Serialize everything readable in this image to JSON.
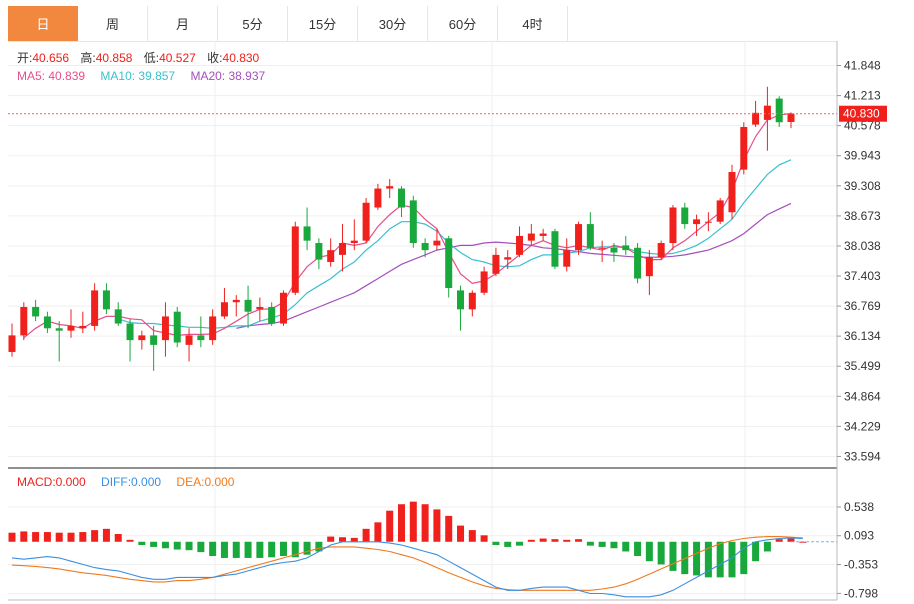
{
  "tabs": [
    {
      "label": "日",
      "active": true
    },
    {
      "label": "周"
    },
    {
      "label": "月"
    },
    {
      "label": "5分"
    },
    {
      "label": "15分"
    },
    {
      "label": "30分"
    },
    {
      "label": "60分"
    },
    {
      "label": "4时"
    }
  ],
  "colors": {
    "up": "#f0201c",
    "down": "#18a83b",
    "ma5": "#e5508a",
    "ma10": "#39c0d0",
    "ma20": "#a44fbd",
    "diff": "#3b8fe0",
    "dea": "#f07a1e",
    "grid": "#efefef",
    "price_line": "#f06060"
  },
  "ohlc": {
    "open_label": "开:",
    "open": "40.656",
    "high_label": "高:",
    "high": "40.858",
    "low_label": "低:",
    "low": "40.527",
    "close_label": "收:",
    "close": "40.830"
  },
  "ma": {
    "ma5_label": "MA5: ",
    "ma5": "40.839",
    "ma10_label": "MA10: ",
    "ma10": "39.857",
    "ma20_label": "MA20: ",
    "ma20": "38.937"
  },
  "macd_legend": {
    "macd_label": "MACD:",
    "macd": "0.000",
    "diff_label": "DIFF:",
    "diff": "0.000",
    "dea_label": "DEA:",
    "dea": "0.000"
  },
  "chart_data": [
    {
      "type": "candlestick",
      "y_ticks": [
        "41.848",
        "41.213",
        "40.578",
        "39.943",
        "39.308",
        "38.673",
        "38.038",
        "37.403",
        "36.769",
        "36.134",
        "35.499",
        "34.864",
        "34.229",
        "33.594"
      ],
      "ylim": [
        33.35,
        42.07
      ],
      "current_price": "40.830",
      "candles": [
        [
          35.8,
          36.15,
          35.7,
          36.4
        ],
        [
          36.15,
          36.75,
          36.05,
          36.85
        ],
        [
          36.75,
          36.55,
          36.45,
          36.9
        ],
        [
          36.55,
          36.3,
          36.2,
          36.65
        ],
        [
          36.3,
          36.25,
          35.6,
          36.45
        ],
        [
          36.25,
          36.35,
          36.1,
          36.7
        ],
        [
          36.3,
          36.35,
          36.2,
          36.65
        ],
        [
          36.35,
          37.1,
          36.25,
          37.25
        ],
        [
          37.1,
          36.7,
          36.6,
          37.25
        ],
        [
          36.7,
          36.4,
          36.35,
          36.85
        ],
        [
          36.4,
          36.05,
          35.6,
          36.5
        ],
        [
          36.05,
          36.15,
          35.85,
          36.25
        ],
        [
          36.15,
          35.95,
          35.4,
          36.35
        ],
        [
          36.05,
          36.55,
          35.7,
          36.85
        ],
        [
          36.65,
          36.0,
          35.9,
          36.75
        ],
        [
          35.95,
          36.15,
          35.6,
          36.3
        ],
        [
          36.15,
          36.05,
          35.9,
          36.55
        ],
        [
          36.05,
          36.55,
          35.95,
          36.7
        ],
        [
          36.55,
          36.85,
          36.5,
          37.15
        ],
        [
          36.85,
          36.9,
          36.55,
          37.0
        ],
        [
          36.9,
          36.65,
          36.3,
          37.2
        ],
        [
          36.7,
          36.75,
          36.45,
          36.95
        ],
        [
          36.75,
          36.4,
          36.35,
          36.85
        ],
        [
          36.4,
          37.05,
          36.35,
          37.1
        ],
        [
          37.05,
          38.45,
          37.0,
          38.55
        ],
        [
          38.45,
          38.15,
          37.95,
          38.85
        ],
        [
          38.1,
          37.75,
          37.55,
          38.2
        ],
        [
          37.7,
          37.95,
          37.6,
          38.2
        ],
        [
          37.85,
          38.1,
          37.5,
          38.5
        ],
        [
          38.1,
          38.15,
          37.95,
          38.6
        ],
        [
          38.15,
          38.95,
          38.1,
          39.05
        ],
        [
          38.85,
          39.25,
          38.8,
          39.35
        ],
        [
          39.25,
          39.3,
          39.05,
          39.45
        ],
        [
          39.25,
          38.85,
          38.65,
          39.3
        ],
        [
          39.0,
          38.1,
          38.0,
          39.1
        ],
        [
          38.1,
          37.95,
          37.8,
          38.2
        ],
        [
          38.05,
          38.15,
          37.95,
          38.4
        ],
        [
          38.2,
          37.15,
          36.95,
          38.25
        ],
        [
          37.1,
          36.7,
          36.25,
          37.2
        ],
        [
          36.7,
          37.05,
          36.55,
          37.1
        ],
        [
          37.05,
          37.5,
          37.0,
          37.6
        ],
        [
          37.45,
          37.85,
          37.4,
          38.0
        ],
        [
          37.75,
          37.8,
          37.55,
          37.95
        ],
        [
          37.85,
          38.25,
          37.8,
          38.45
        ],
        [
          38.15,
          38.3,
          38.05,
          38.5
        ],
        [
          38.25,
          38.3,
          38.15,
          38.4
        ],
        [
          38.35,
          37.6,
          37.55,
          38.4
        ],
        [
          37.6,
          37.95,
          37.5,
          38.2
        ],
        [
          37.95,
          38.5,
          37.85,
          38.55
        ],
        [
          38.5,
          38.0,
          37.95,
          38.75
        ],
        [
          38.0,
          38.0,
          37.7,
          38.15
        ],
        [
          38.0,
          37.9,
          37.7,
          38.1
        ],
        [
          38.05,
          37.95,
          37.85,
          38.25
        ],
        [
          38.0,
          37.35,
          37.25,
          38.1
        ],
        [
          37.4,
          37.8,
          37.0,
          37.95
        ],
        [
          37.8,
          38.1,
          37.75,
          38.15
        ],
        [
          38.1,
          38.85,
          37.95,
          38.9
        ],
        [
          38.85,
          38.5,
          38.4,
          38.95
        ],
        [
          38.5,
          38.6,
          38.25,
          38.7
        ],
        [
          38.55,
          38.55,
          38.35,
          38.75
        ],
        [
          38.55,
          39.0,
          38.5,
          39.05
        ],
        [
          38.75,
          39.6,
          38.6,
          39.75
        ],
        [
          39.65,
          40.55,
          39.55,
          40.65
        ],
        [
          40.6,
          40.85,
          40.55,
          41.1
        ],
        [
          40.7,
          41.0,
          40.05,
          41.4
        ],
        [
          41.15,
          40.65,
          40.55,
          41.2
        ],
        [
          40.656,
          40.83,
          40.527,
          40.858
        ]
      ],
      "ma5": [
        null,
        36.1,
        36.3,
        36.45,
        36.38,
        36.35,
        36.3,
        36.45,
        36.55,
        36.55,
        36.5,
        36.48,
        36.25,
        36.2,
        36.15,
        36.17,
        36.17,
        36.18,
        36.3,
        36.45,
        36.6,
        36.7,
        36.71,
        36.85,
        37.28,
        37.6,
        37.8,
        37.85,
        38.1,
        38.05,
        38.1,
        38.45,
        38.7,
        38.9,
        38.85,
        38.6,
        38.4,
        37.9,
        37.45,
        37.25,
        37.3,
        37.45,
        37.65,
        37.85,
        38.05,
        38.15,
        38.05,
        38.0,
        38.05,
        38.0,
        37.95,
        38.05,
        38.0,
        37.85,
        37.75,
        37.75,
        38.0,
        38.15,
        38.35,
        38.55,
        38.75,
        39.2,
        39.85,
        40.35,
        40.7,
        40.8,
        40.839
      ],
      "ma10": [
        null,
        null,
        null,
        null,
        null,
        null,
        null,
        null,
        null,
        36.5,
        36.42,
        36.4,
        36.4,
        36.37,
        36.35,
        36.32,
        36.32,
        36.3,
        36.32,
        36.35,
        36.35,
        36.45,
        36.52,
        36.6,
        36.8,
        37.05,
        37.2,
        37.35,
        37.55,
        37.7,
        37.95,
        38.15,
        38.4,
        38.55,
        38.55,
        38.5,
        38.35,
        38.1,
        37.9,
        37.75,
        37.7,
        37.62,
        37.6,
        37.62,
        37.75,
        37.85,
        37.85,
        37.88,
        37.92,
        38.0,
        38.02,
        38.02,
        38.0,
        37.92,
        37.88,
        37.86,
        37.88,
        37.95,
        38.05,
        38.2,
        38.4,
        38.6,
        38.95,
        39.25,
        39.55,
        39.75,
        39.857
      ],
      "ma20": [
        null,
        null,
        null,
        null,
        null,
        null,
        null,
        null,
        null,
        null,
        null,
        null,
        null,
        null,
        null,
        null,
        null,
        null,
        null,
        36.3,
        36.35,
        36.38,
        36.4,
        36.45,
        36.55,
        36.65,
        36.75,
        36.85,
        36.95,
        37.05,
        37.2,
        37.35,
        37.5,
        37.65,
        37.75,
        37.85,
        37.95,
        38.0,
        38.05,
        38.05,
        38.1,
        38.12,
        38.1,
        38.08,
        38.05,
        38.0,
        37.98,
        37.95,
        37.92,
        37.88,
        37.86,
        37.84,
        37.82,
        37.8,
        37.8,
        37.8,
        37.82,
        37.85,
        37.9,
        37.95,
        38.05,
        38.15,
        38.3,
        38.5,
        38.7,
        38.82,
        38.937
      ]
    },
    {
      "type": "macd",
      "y_ticks": [
        "0.538",
        "0.093",
        "-0.353",
        "-0.798"
      ],
      "ylim": [
        -0.9,
        0.8
      ],
      "histogram": [
        0.14,
        0.16,
        0.15,
        0.15,
        0.14,
        0.14,
        0.15,
        0.18,
        0.2,
        0.12,
        0.03,
        -0.05,
        -0.08,
        -0.1,
        -0.12,
        -0.13,
        -0.16,
        -0.22,
        -0.25,
        -0.25,
        -0.25,
        -0.25,
        -0.24,
        -0.22,
        -0.24,
        -0.2,
        -0.15,
        0.08,
        0.07,
        0.06,
        0.2,
        0.3,
        0.48,
        0.58,
        0.62,
        0.58,
        0.5,
        0.4,
        0.25,
        0.18,
        0.1,
        -0.05,
        -0.08,
        -0.06,
        0.03,
        0.05,
        0.04,
        0.03,
        0.04,
        -0.06,
        -0.08,
        -0.1,
        -0.15,
        -0.22,
        -0.3,
        -0.35,
        -0.45,
        -0.5,
        -0.52,
        -0.55,
        -0.55,
        -0.55,
        -0.5,
        -0.3,
        -0.15,
        0.04,
        0.05,
        0.0
      ],
      "diff": [
        -0.25,
        -0.27,
        -0.25,
        -0.23,
        -0.25,
        -0.3,
        -0.35,
        -0.4,
        -0.43,
        -0.45,
        -0.5,
        -0.55,
        -0.58,
        -0.58,
        -0.55,
        -0.55,
        -0.55,
        -0.55,
        -0.52,
        -0.5,
        -0.45,
        -0.4,
        -0.35,
        -0.32,
        -0.3,
        -0.25,
        -0.15,
        -0.05,
        0.0,
        0.0,
        0.0,
        0.0,
        -0.02,
        -0.05,
        -0.1,
        -0.15,
        -0.2,
        -0.3,
        -0.4,
        -0.5,
        -0.6,
        -0.7,
        -0.75,
        -0.75,
        -0.72,
        -0.7,
        -0.7,
        -0.7,
        -0.75,
        -0.8,
        -0.8,
        -0.82,
        -0.85,
        -0.85,
        -0.85,
        -0.82,
        -0.75,
        -0.65,
        -0.55,
        -0.45,
        -0.35,
        -0.25,
        -0.1,
        0.0,
        0.03,
        0.05,
        0.06,
        0.05
      ],
      "dea": [
        -0.36,
        -0.37,
        -0.38,
        -0.4,
        -0.42,
        -0.45,
        -0.48,
        -0.5,
        -0.52,
        -0.55,
        -0.58,
        -0.6,
        -0.62,
        -0.62,
        -0.6,
        -0.6,
        -0.58,
        -0.55,
        -0.5,
        -0.45,
        -0.4,
        -0.35,
        -0.3,
        -0.25,
        -0.2,
        -0.15,
        -0.1,
        -0.08,
        -0.08,
        -0.08,
        -0.1,
        -0.12,
        -0.15,
        -0.2,
        -0.25,
        -0.32,
        -0.4,
        -0.48,
        -0.55,
        -0.62,
        -0.68,
        -0.72,
        -0.74,
        -0.75,
        -0.75,
        -0.75,
        -0.75,
        -0.75,
        -0.75,
        -0.75,
        -0.73,
        -0.7,
        -0.65,
        -0.58,
        -0.5,
        -0.42,
        -0.34,
        -0.26,
        -0.18,
        -0.1,
        -0.03,
        0.02,
        0.05,
        0.07,
        0.08,
        0.08,
        0.07,
        0.06
      ]
    }
  ]
}
